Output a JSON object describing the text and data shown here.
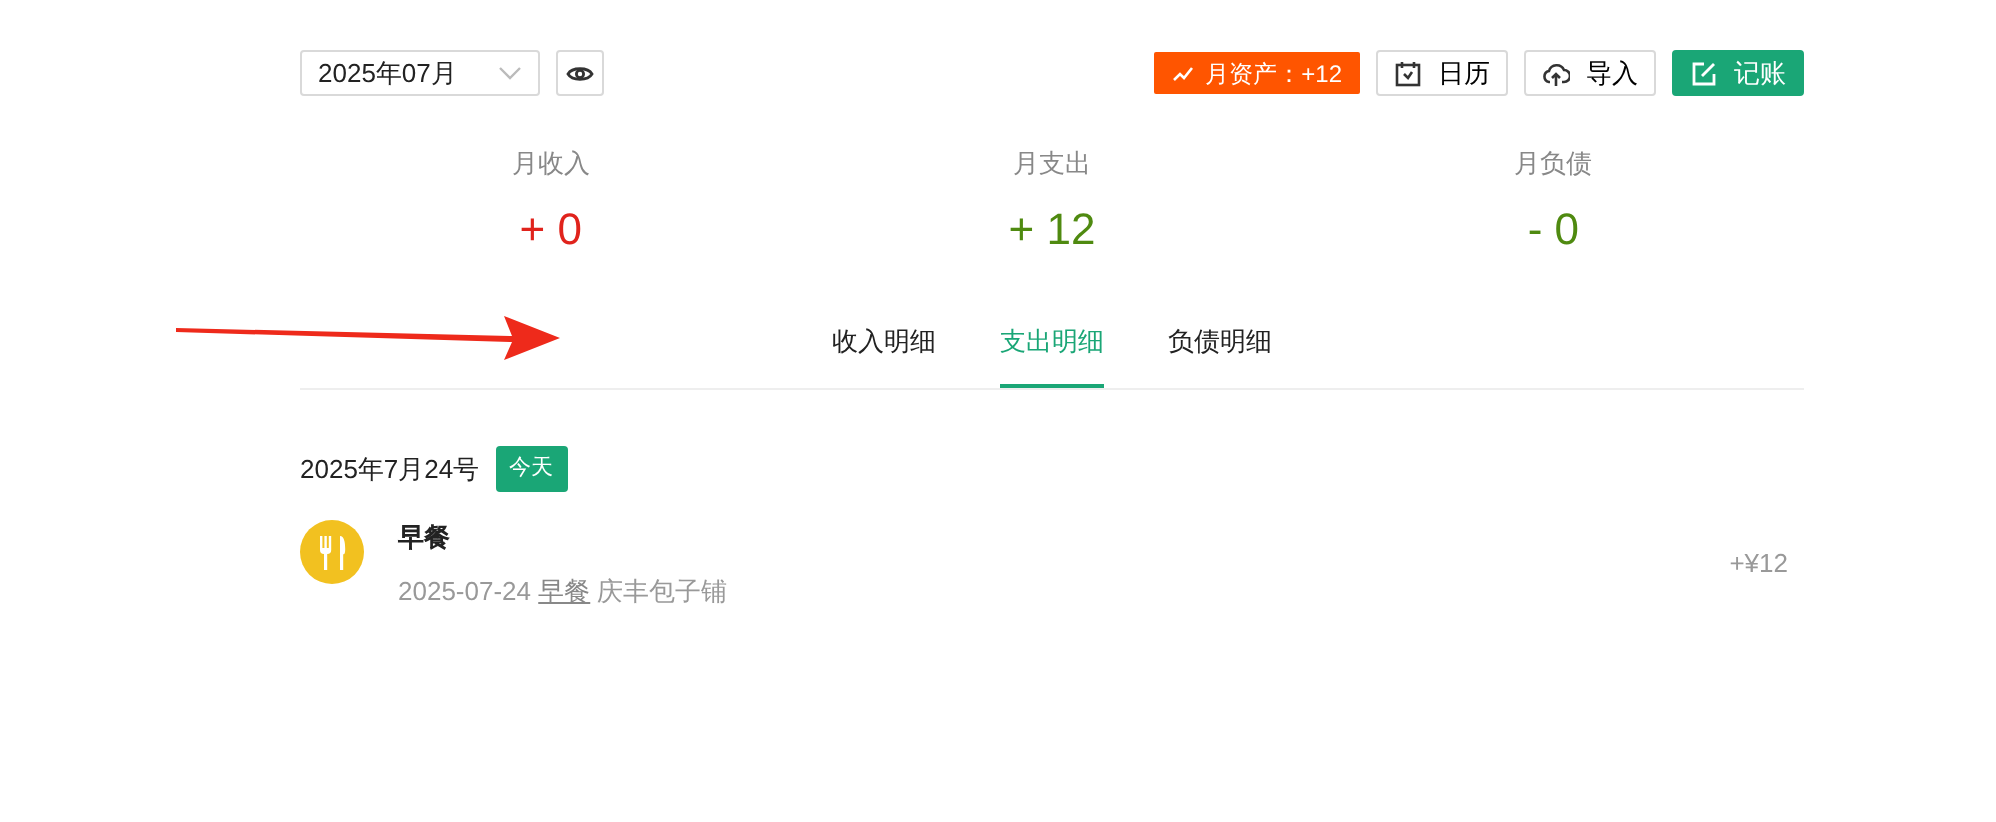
{
  "toolbar": {
    "month": "2025年07月",
    "asset_badge": "月资产：+12",
    "buttons": [
      {
        "kind": "calendar",
        "label": "日历"
      },
      {
        "kind": "import",
        "label": "导入"
      },
      {
        "kind": "record",
        "label": "记账"
      }
    ]
  },
  "summary": [
    {
      "label": "月收入",
      "value": "+ 0",
      "color": "#e0231c"
    },
    {
      "label": "月支出",
      "value": "+ 12",
      "color": "#4f8a10"
    },
    {
      "label": "月负债",
      "value": "- 0",
      "color": "#4f8a10"
    }
  ],
  "tabs": [
    {
      "label": "收入明细",
      "selected": false
    },
    {
      "label": "支出明细",
      "selected": true
    },
    {
      "label": "负债明细",
      "selected": false
    }
  ],
  "day": {
    "date": "2025年7月24号",
    "badge": "今天"
  },
  "entries": [
    {
      "title": "早餐",
      "date": "2025-07-24",
      "category": "早餐",
      "note": "庆丰包子铺",
      "amount": "+¥12"
    }
  ]
}
